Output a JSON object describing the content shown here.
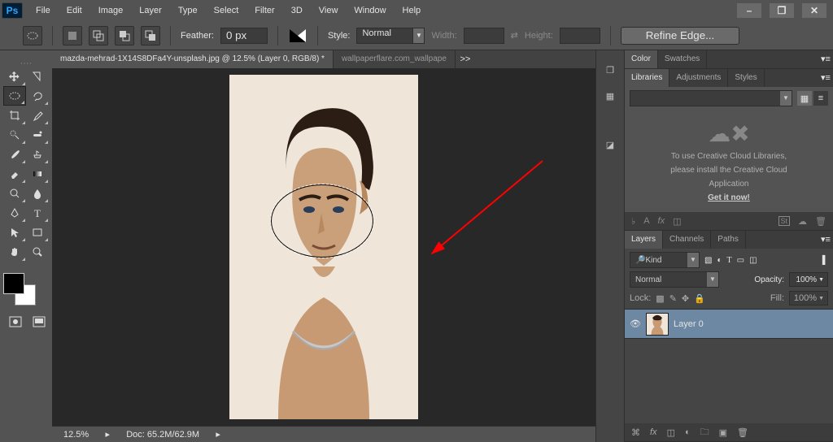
{
  "app": {
    "logo": "Ps"
  },
  "menus": [
    "File",
    "Edit",
    "Image",
    "Layer",
    "Type",
    "Select",
    "Filter",
    "3D",
    "View",
    "Window",
    "Help"
  ],
  "options_bar": {
    "feather_label": "Feather:",
    "feather_value": "0 px",
    "style_label": "Style:",
    "style_value": "Normal",
    "width_label": "Width:",
    "height_label": "Height:",
    "refine_label": "Refine Edge..."
  },
  "tabs": {
    "active": "mazda-mehrad-1X14S8DFa4Y-unsplash.jpg @ 12.5% (Layer 0, RGB/8) *",
    "inactive": "wallpaperflare.com_wallpape",
    "more": ">>"
  },
  "status": {
    "zoom": "12.5%",
    "doc": "Doc: 65.2M/62.9M"
  },
  "panels": {
    "color_tab": "Color",
    "swatches_tab": "Swatches",
    "libraries_tab": "Libraries",
    "adjustments_tab": "Adjustments",
    "styles_tab": "Styles",
    "lib_msg1": "To use Creative Cloud Libraries,",
    "lib_msg2": "please install the Creative Cloud",
    "lib_msg3": "Application",
    "lib_link": "Get it now!",
    "layers_tab": "Layers",
    "channels_tab": "Channels",
    "paths_tab": "Paths",
    "filter_kind": "Kind",
    "blend_mode": "Normal",
    "opacity_label": "Opacity:",
    "opacity_value": "100%",
    "lock_label": "Lock:",
    "fill_label": "Fill:",
    "fill_value": "100%",
    "layer_name": "Layer 0"
  },
  "filter_icon_badge": "St"
}
